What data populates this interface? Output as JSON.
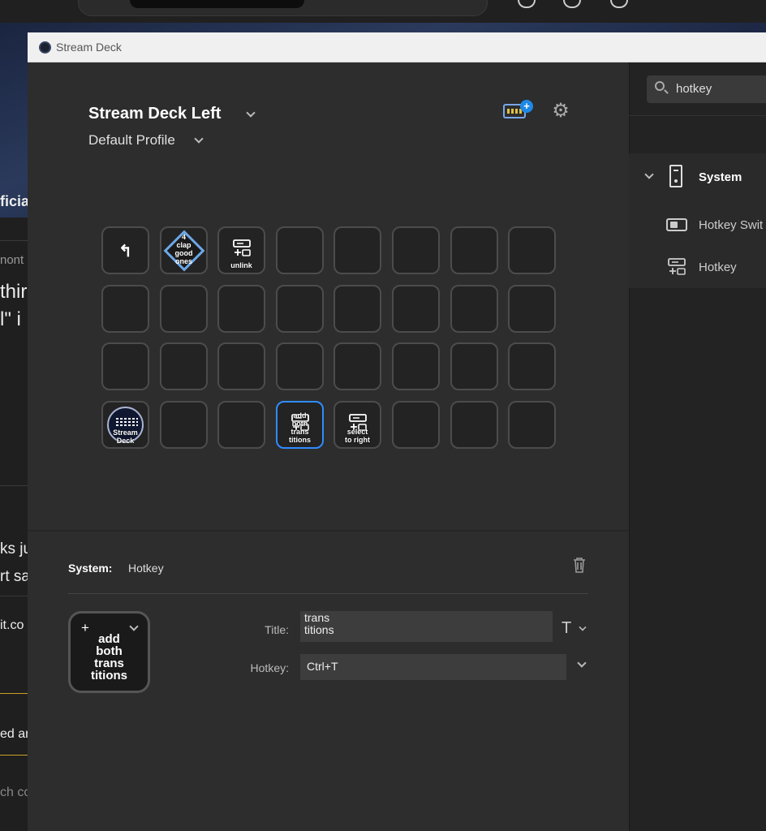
{
  "window": {
    "title": "Stream Deck"
  },
  "header": {
    "device_name": "Stream Deck Left",
    "profile_name": "Default Profile",
    "store_badge": "+"
  },
  "keys": [
    {
      "row": 0,
      "col": 0,
      "kind": "back",
      "icon": "back-arrow-icon",
      "symbol": "↰",
      "label": ""
    },
    {
      "row": 0,
      "col": 1,
      "kind": "diamond",
      "icon": "diamond-icon",
      "label": "4\nclap\ngood\nones"
    },
    {
      "row": 0,
      "col": 2,
      "kind": "hotkey",
      "icon": "hotkey-icon",
      "label": "unlink"
    },
    {
      "row": 3,
      "col": 0,
      "kind": "logo",
      "icon": "stream-deck-logo-icon",
      "label": "Stream\nDeck"
    },
    {
      "row": 3,
      "col": 3,
      "kind": "hotkey",
      "icon": "hotkey-icon",
      "label": "add\nboth\ntrans\ntitions",
      "selected": true
    },
    {
      "row": 3,
      "col": 4,
      "kind": "hotkey",
      "icon": "hotkey-icon",
      "label": "select\nto right"
    }
  ],
  "inspector": {
    "category": "System:",
    "action": "Hotkey",
    "preview_label": "add\nboth\ntrans\ntitions",
    "preview_plus": "+",
    "title_label": "Title:",
    "title_value": "trans\ntitions",
    "title_font_icon": "T",
    "hotkey_label": "Hotkey:",
    "hotkey_value": "Ctrl+T"
  },
  "actions_panel": {
    "search_value": "hotkey",
    "category": "System",
    "items": [
      {
        "label": "Hotkey Swit",
        "icon": "hotkey-switch-icon"
      },
      {
        "label": "Hotkey",
        "icon": "hotkey-icon"
      }
    ]
  },
  "background": {
    "left_strip_texts": [
      {
        "text": "ficia",
        "top": 0
      },
      {
        "text": "nont",
        "top": 0
      },
      {
        "text": "thir",
        "top": 0
      },
      {
        "text": "l\" i",
        "top": 0
      },
      {
        "text": "ks ju",
        "top": 0
      },
      {
        "text": "rt sa",
        "top": 0
      },
      {
        "text": "it.co",
        "top": 0
      },
      {
        "text": "ed ar",
        "top": 0
      },
      {
        "text": "ch co",
        "top": 0
      }
    ]
  },
  "colors": {
    "accent": "#2f8cff",
    "window_bg": "#2d2d2d",
    "panel_bg": "#232323"
  }
}
